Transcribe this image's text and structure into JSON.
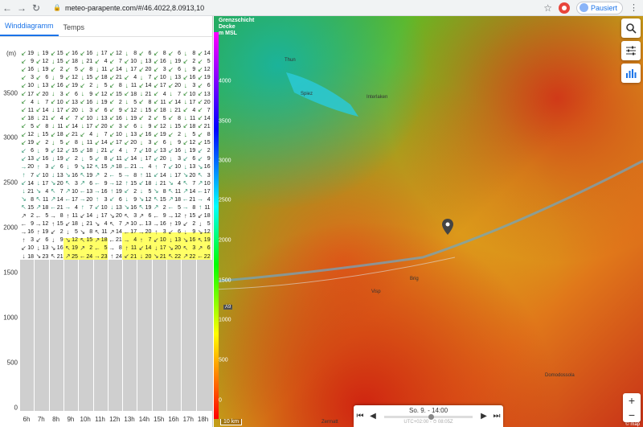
{
  "browser": {
    "back_icon": "arrow-left-icon",
    "forward_icon": "arrow-right-icon",
    "reload_icon": "reload-icon",
    "url": "meteo-parapente.com/#/46.4022,8.0913,10",
    "profile_label": "Pausiert"
  },
  "tabs": [
    {
      "label": "Winddiagramm",
      "active": true
    },
    {
      "label": "Temps",
      "active": false
    }
  ],
  "windgram": {
    "y_unit": "(m)",
    "y_ticks": [
      "3500",
      "3000",
      "2500",
      "2000",
      "1500",
      "1000",
      "500",
      "0"
    ],
    "hours": [
      "6h",
      "7h",
      "8h",
      "9h",
      "10h",
      "11h",
      "12h",
      "13h",
      "14h",
      "15h",
      "16h",
      "17h",
      "18h"
    ],
    "bottom_values": [
      "18",
      "23",
      "21",
      "25",
      "24",
      "23",
      "24",
      "21",
      "20",
      "21",
      "22",
      "22",
      "22"
    ],
    "top_values": [
      "19",
      "19",
      "15",
      "16",
      "16",
      "17",
      "12",
      "8",
      "6",
      "8",
      "6",
      "8",
      "14"
    ]
  },
  "map": {
    "scale_title": [
      "Grenzschicht",
      "Decke",
      "m MSL"
    ],
    "scale_ticks": [
      "4000",
      "3500",
      "3000",
      "2500",
      "2000",
      "1500",
      "1000",
      "500",
      "0"
    ],
    "scale_km": "10 km",
    "time_label": "So. 9. - 14:00",
    "timezone": "UTC+02:00 - ⏱ 08:05Z",
    "attribution": "© map",
    "places": [
      "Thun",
      "Spiez",
      "Interlaken",
      "Brig",
      "Visp",
      "Zermatt",
      "Domodossola",
      "A9"
    ]
  },
  "colors": {
    "accent": "#1a73e8",
    "yellow_highlight": "#ffff66",
    "arrow_green": "#2e8b2e"
  }
}
